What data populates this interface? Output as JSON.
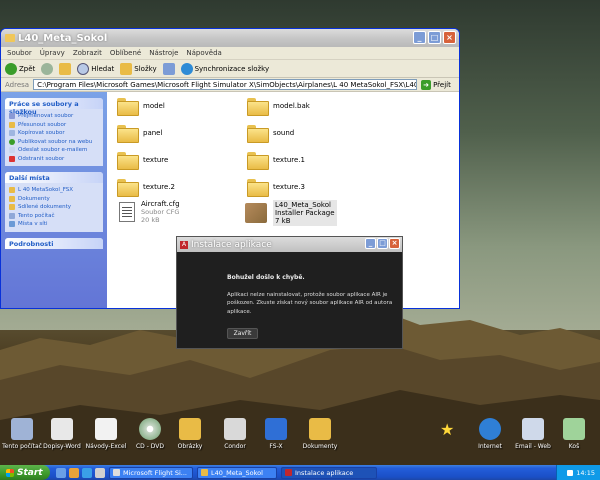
{
  "explorer": {
    "title": "L40_Meta_Sokol",
    "menu": [
      "Soubor",
      "Úpravy",
      "Zobrazit",
      "Oblíbené",
      "Nástroje",
      "Nápověda"
    ],
    "toolbar": {
      "back": "Zpět",
      "search": "Hledat",
      "folders": "Složky",
      "sync": "Synchronizace složky"
    },
    "address_label": "Adresa",
    "address": "C:\\Program Files\\Microsoft Games\\Microsoft Flight Simulator X\\SimObjects\\Airplanes\\L 40 MetaSokol_FSX\\L40_Meta_Sokol",
    "go": "Přejít",
    "tasks_title": "Práce se soubory a složkou",
    "tasks": [
      "Přejmenovat soubor",
      "Přesunout soubor",
      "Kopírovat soubor",
      "Publikovat soubor na webu",
      "Odeslat soubor e-mailem",
      "Odstranit soubor"
    ],
    "places_title": "Další místa",
    "places": [
      "L 40 MetaSokol_FSX",
      "Dokumenty",
      "Sdílené dokumenty",
      "Tento počítač",
      "Místa v síti"
    ],
    "details_title": "Podrobnosti",
    "folders": [
      "model",
      "model.bak",
      "panel",
      "sound",
      "texture",
      "texture.1",
      "texture.2",
      "texture.3"
    ],
    "file1": {
      "name": "Aircraft.cfg",
      "type": "Soubor CFG",
      "size": "20 kB"
    },
    "file2": {
      "name": "L40_Meta_Sokol",
      "type": "Installer Package",
      "size": "7 kB"
    }
  },
  "dialog": {
    "title": "Instalace aplikace",
    "heading": "Bohužel došlo k chybě.",
    "message": "Aplikaci nelze nainstalovat, protože soubor aplikace AIR je poškozen. Zkuste získat nový soubor aplikace AIR od autora aplikace.",
    "close": "Zavřít"
  },
  "desktop_icons": [
    "Tento počítač",
    "Dopisy-Word",
    "Návody-Excel",
    "CD - DVD",
    "Obrázky",
    "Condor",
    "FS-X",
    "Dokumenty",
    "Internet",
    "Email - Web",
    "Koš"
  ],
  "taskbar": {
    "start": "Start",
    "tasks": [
      "Microsoft Flight Si...",
      "L40_Meta_Sokol",
      "Instalace aplikace"
    ],
    "clock": "14:15"
  },
  "colors": {
    "taskbar": "#245edb",
    "start": "#3c9a2b",
    "dialog_bg": "#1f1f1f",
    "sidebar": "#6375d6"
  }
}
